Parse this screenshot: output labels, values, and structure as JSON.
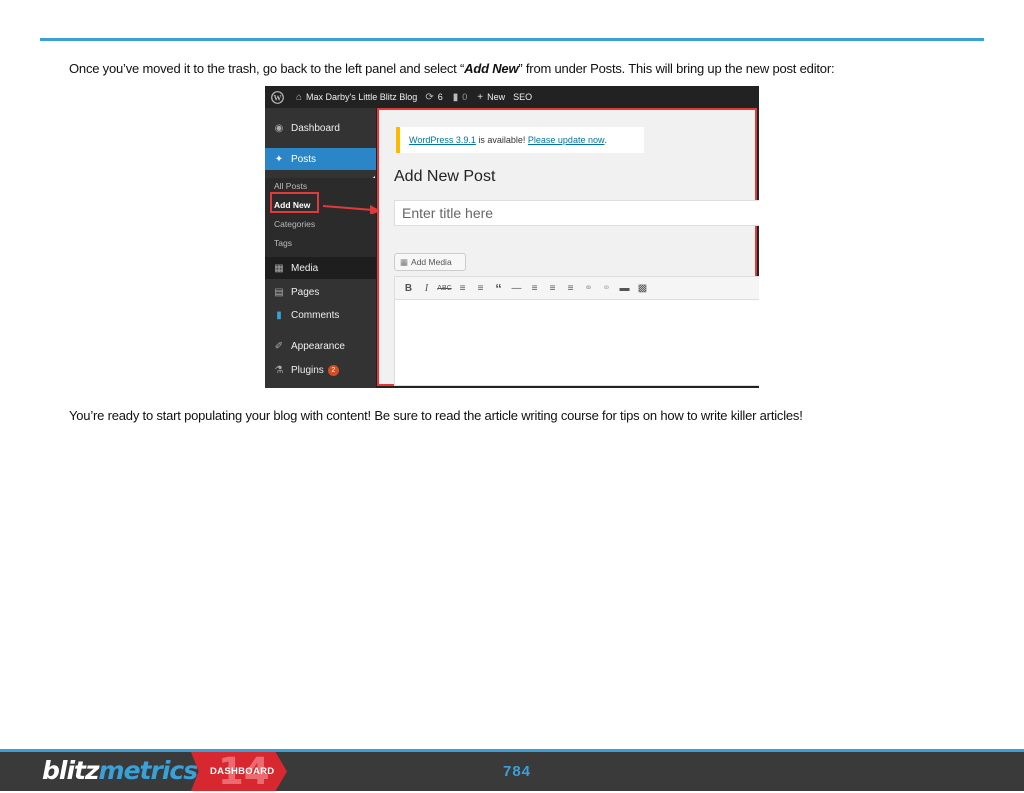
{
  "document": {
    "intro": {
      "before": "Once you’ve moved it to the trash, go back to the left panel and select “",
      "emphasis": "Add New",
      "after": "” from under Posts. This will bring up the new post editor:"
    },
    "closing": "You’re ready to start populating your blog with content! Be sure to read the article writing course for tips on how to write killer articles!"
  },
  "screenshot": {
    "admin_bar": {
      "site_name": "Max Darby's Little Blitz Blog",
      "updates_count": "6",
      "comments_count": "0",
      "new_label": "New",
      "seo_label": "SEO"
    },
    "sidebar": {
      "dashboard": "Dashboard",
      "posts": "Posts",
      "submenu": [
        "All Posts",
        "Add New",
        "Categories",
        "Tags"
      ],
      "media": "Media",
      "pages": "Pages",
      "comments": "Comments",
      "appearance": "Appearance",
      "plugins": "Plugins",
      "plugins_badge": "2"
    },
    "notice": {
      "version_link": "WordPress 3.9.1",
      "middle": " is available! ",
      "update_link": "Please update now",
      "end": "."
    },
    "page_title": "Add New Post",
    "title_placeholder": "Enter title here",
    "add_media_label": "Add Media",
    "toolbar_icons": [
      "bold-icon",
      "italic-icon",
      "strikethrough-icon",
      "bullet-list-icon",
      "numbered-list-icon",
      "blockquote-icon",
      "horizontal-rule-icon",
      "align-left-icon",
      "align-center-icon",
      "align-right-icon",
      "link-icon",
      "unlink-icon",
      "read-more-icon",
      "toolbar-toggle-icon"
    ],
    "colors": {
      "highlight": "#e23a3a",
      "accent": "#2a86c7",
      "notice": "#ffba00"
    }
  },
  "footer": {
    "logo_part1": "blitz",
    "logo_part2": "metrics",
    "badge_number": "14",
    "badge_label": "DASHBOARD",
    "page_number": "784"
  }
}
